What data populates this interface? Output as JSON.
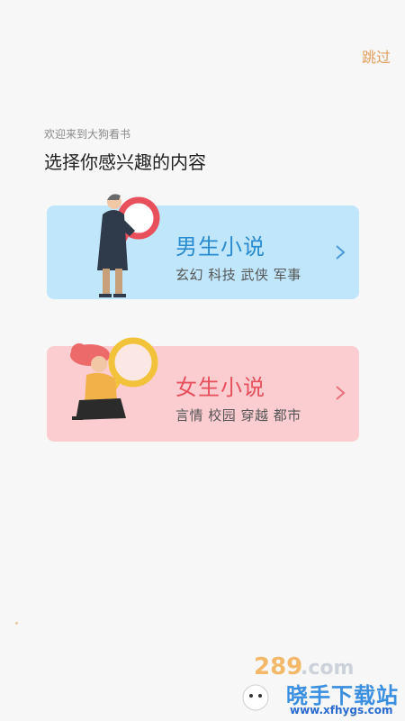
{
  "header": {
    "skip_label": "跳过"
  },
  "intro": {
    "welcome": "欢迎来到大狗看书",
    "headline": "选择你感兴趣的内容"
  },
  "categories": [
    {
      "title": "男生小说",
      "tags": "玄幻 科技 武侠 军事",
      "color": "#2a8bd0",
      "background": "#bfe6fb"
    },
    {
      "title": "女生小说",
      "tags": "言情 校园 穿越 都市",
      "color": "#e8505b",
      "background": "#fbcdd1"
    }
  ],
  "watermark": {
    "logo": "289.com",
    "cn_text": "晓手下载站",
    "url": "www.xfhygs.com"
  }
}
